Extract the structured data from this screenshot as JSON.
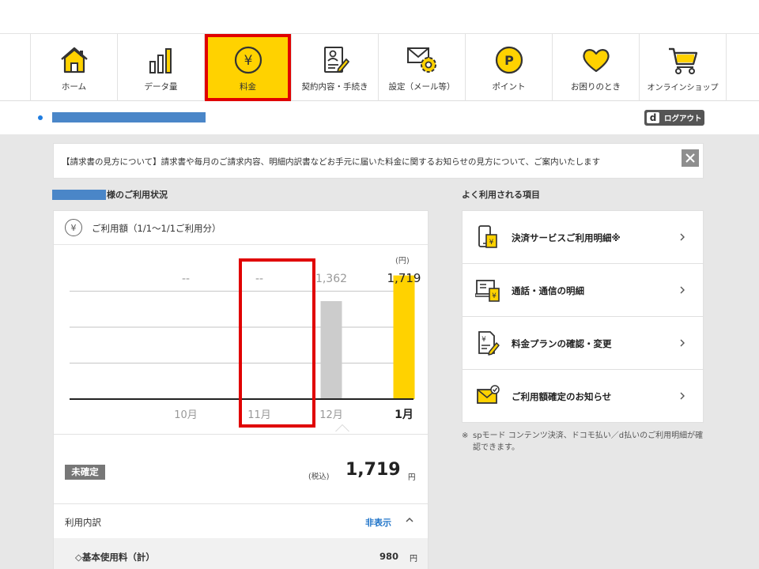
{
  "nav": {
    "items": [
      {
        "label": "ホーム",
        "icon": "home-icon"
      },
      {
        "label": "データ量",
        "icon": "bar-chart-icon"
      },
      {
        "label": "料金",
        "icon": "yen-icon",
        "active": true
      },
      {
        "label": "契約内容・手続き",
        "icon": "contract-icon"
      },
      {
        "label": "設定（メール等）",
        "icon": "settings-mail-icon"
      },
      {
        "label": "ポイント",
        "icon": "point-icon"
      },
      {
        "label": "お困りのとき",
        "icon": "heart-icon"
      },
      {
        "label": "オンラインショップ",
        "icon": "cart-icon"
      }
    ]
  },
  "header": {
    "logout_d": "d",
    "logout_label": "ログアウト"
  },
  "notice": {
    "text": "【請求書の見方について】請求書や毎月のご請求内容、明細内訳書などお手元に届いた料金に関するお知らせの見方について、ご案内いたします",
    "close": "×"
  },
  "usage": {
    "heading": "様のご利用状況",
    "yen_symbol": "¥",
    "period": "ご利用額（1/1〜1/1ご利用分）",
    "status": "未確定",
    "tax_label": "(税込)",
    "total": "1,719",
    "total_unit": "円",
    "breakdown_label": "利用内訳",
    "toggle_label": "非表示",
    "base_fee_label": "◇基本使用料（計）",
    "base_fee_value": "980",
    "base_fee_unit": "円"
  },
  "chart_data": {
    "type": "bar",
    "unit": "(円)",
    "categories": [
      "10月",
      "11月",
      "12月",
      "1月"
    ],
    "values": [
      null,
      null,
      1362,
      1719
    ],
    "value_labels": [
      "--",
      "--",
      "1,362",
      "1,719"
    ],
    "ylim": [
      0,
      2000
    ],
    "grid": true,
    "colors": {
      "past": "#cccccc",
      "current": "#ffd200"
    }
  },
  "frequent": {
    "heading": "よく利用される項目",
    "items": [
      {
        "label": "決済サービスご利用明細※",
        "icon": "payment-phone-icon"
      },
      {
        "label": "通話・通信の明細",
        "icon": "call-detail-icon"
      },
      {
        "label": "料金プランの確認・変更",
        "icon": "plan-document-icon"
      },
      {
        "label": "ご利用額確定のお知らせ",
        "icon": "notice-mail-icon"
      }
    ]
  },
  "footnote": {
    "mark": "※",
    "text": "spモード コンテンツ決済、ドコモ払い／d払いのご利用明細が確認できます。"
  },
  "colors": {
    "accent": "#ffd200",
    "highlight_box": "#e00000",
    "link": "#1e73c8",
    "redaction": "#4a86c8"
  }
}
